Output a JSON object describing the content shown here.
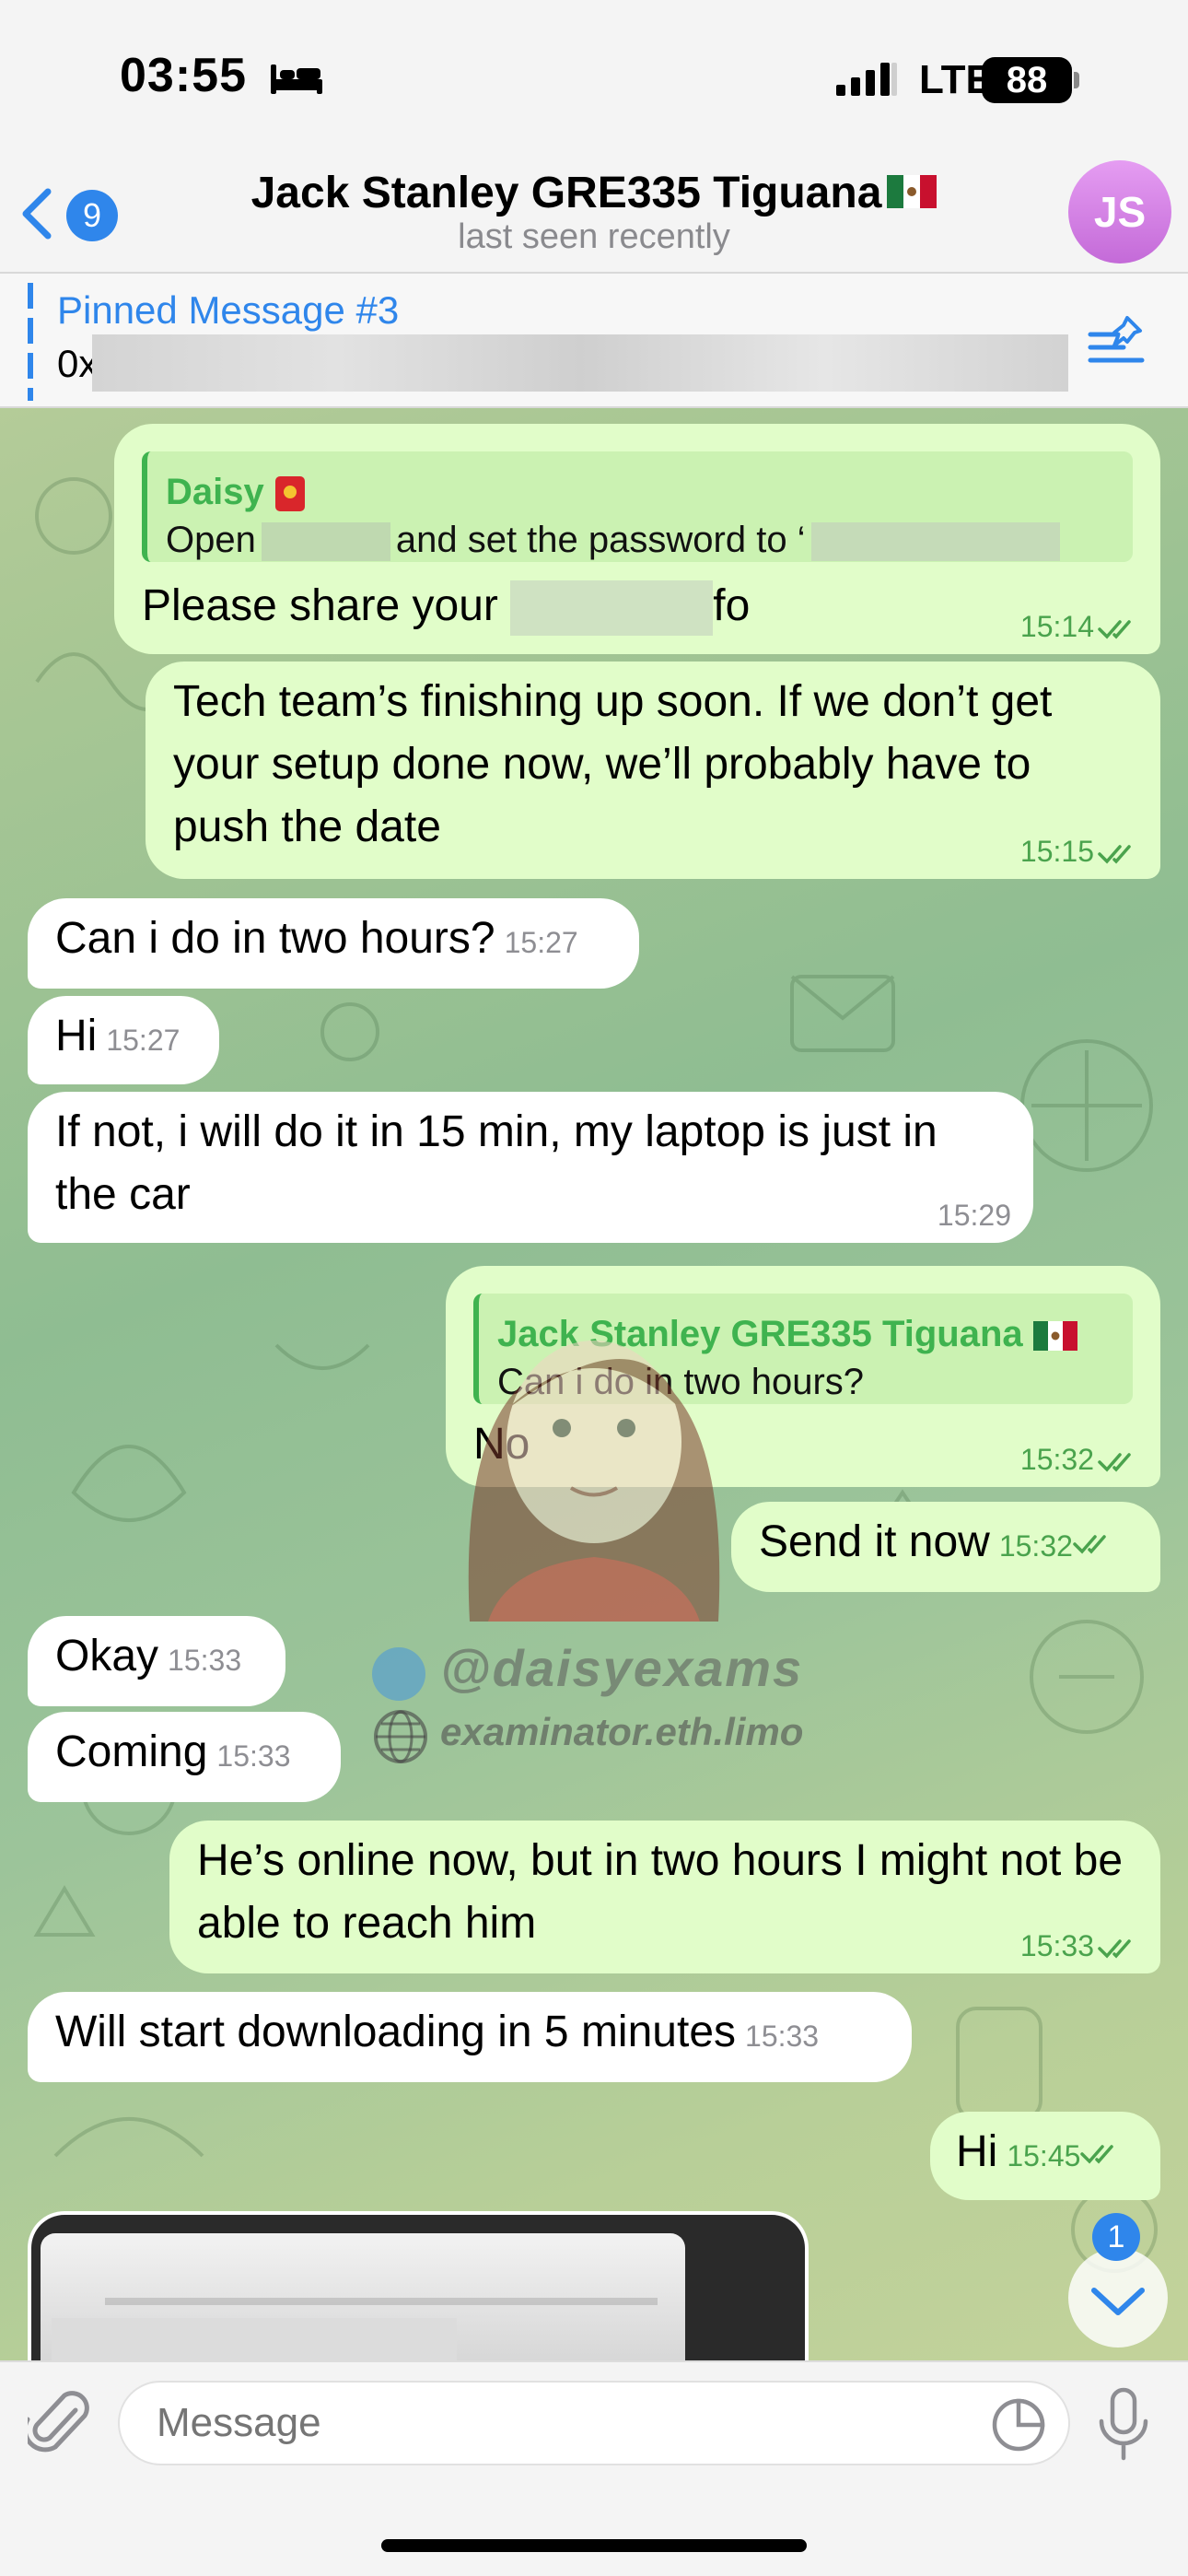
{
  "status_bar": {
    "time": "03:55",
    "network": "LTE",
    "battery": "88"
  },
  "header": {
    "back_count": "9",
    "title": "Jack Stanley GRE335 Tiguana",
    "subtitle": "last seen recently",
    "avatar_initials": "JS",
    "avatar_color": "#d27be6"
  },
  "pinned": {
    "title": "Pinned Message #3",
    "text": "0x"
  },
  "messages": [
    {
      "dir": "out",
      "reply": {
        "name": "Daisy",
        "text_before": "Open",
        "text_after": "and set the password to ‘"
      },
      "text_before": "Please share your",
      "text_after": "fo",
      "time": "15:14"
    },
    {
      "dir": "out",
      "text": "Tech team’s finishing up soon. If we don’t get your setup done now, we’ll probably have to push the date",
      "time": "15:15"
    },
    {
      "dir": "in",
      "text": "Can i do in two hours?",
      "time": "15:27"
    },
    {
      "dir": "in",
      "text": "Hi",
      "time": "15:27"
    },
    {
      "dir": "in",
      "text": "If not, i will do it in 15 min, my laptop is just in the car",
      "time": "15:29"
    },
    {
      "dir": "out",
      "reply": {
        "name": "Jack Stanley GRE335 Tiguana",
        "text": "Can i do in two hours?"
      },
      "text": "No",
      "time": "15:32"
    },
    {
      "dir": "out",
      "text": "Send it now",
      "time": "15:32"
    },
    {
      "dir": "in",
      "text": "Okay",
      "time": "15:33"
    },
    {
      "dir": "in",
      "text": "Coming",
      "time": "15:33"
    },
    {
      "dir": "out",
      "text": "He’s online now, but in two hours I might not be able to reach him",
      "time": "15:33"
    },
    {
      "dir": "in",
      "text": "Will start downloading in 5 minutes",
      "time": "15:33"
    },
    {
      "dir": "out",
      "text": "Hi",
      "time": "15:45"
    }
  ],
  "watermark": {
    "handle": "@daisyexams",
    "site": "examinator.eth.limo"
  },
  "scroll_down_badge": "1",
  "composer": {
    "placeholder": "Message"
  },
  "colors": {
    "outgoing_bubble": "#e1fdc9",
    "incoming_bubble": "#ffffff",
    "accent": "#2f86eb",
    "check_green": "#4aa34d"
  }
}
